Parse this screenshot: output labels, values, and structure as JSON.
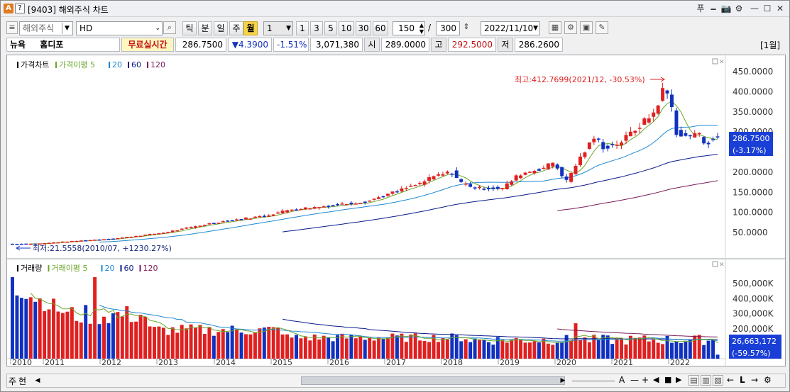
{
  "title": {
    "icon_letter": "A",
    "question": "?",
    "text": "[9403] 해외주식 차트",
    "controls": [
      "푸",
      "🗕",
      "📷",
      "⚙",
      "—",
      "☐",
      "✕"
    ]
  },
  "toolbar": {
    "market_select": "해외주식",
    "symbol": "HD",
    "period_buttons": [
      "틱",
      "분",
      "일",
      "주",
      "월"
    ],
    "active_period": "월",
    "interval_value": "1",
    "interval_buttons": [
      "1",
      "3",
      "5",
      "10",
      "30",
      "60"
    ],
    "count_value": "150",
    "slash": "/",
    "total_value": "300",
    "date_value": "2022/11/10"
  },
  "quote": {
    "exchange": "뉴욕",
    "name": "홈디포",
    "realtime_label": "무료실시간",
    "price": "286.7500",
    "change": "▼4.3900",
    "change_pct": "-1.51%",
    "volume": "3,071,380",
    "open_label": "시",
    "open": "289.0000",
    "high_label": "고",
    "high": "292.5000",
    "low_label": "저",
    "low": "286.2600",
    "period_tag": "[1월]"
  },
  "price_pane": {
    "legend": [
      {
        "label": "가격차트",
        "color": "#000000"
      },
      {
        "label": "가격이평 5",
        "color": "#6aa62a"
      },
      {
        "label": "20",
        "color": "#1e88d2"
      },
      {
        "label": "60",
        "color": "#0a1a8a"
      },
      {
        "label": "120",
        "color": "#7a1a5a"
      }
    ],
    "max_annotation": "최고:412.7699(2021/12, -30.53%)",
    "min_annotation": "최저:21.5558(2010/07, +1230.27%)",
    "axis_labels": [
      "450.0000",
      "400.0000",
      "350.0000",
      "300.0000",
      "250.0000",
      "200.0000",
      "150.0000",
      "100.0000",
      "50.0000"
    ],
    "current_price_tag": "286.7500",
    "current_pct_tag": "(-3.17%)"
  },
  "volume_pane": {
    "legend": [
      {
        "label": "거래량",
        "color": "#000000"
      },
      {
        "label": "거래이평 5",
        "color": "#6aa62a"
      },
      {
        "label": "20",
        "color": "#1e88d2"
      },
      {
        "label": "60",
        "color": "#0a1a8a"
      },
      {
        "label": "120",
        "color": "#7a1a5a"
      }
    ],
    "axis_labels": [
      "500,000K",
      "400,000K",
      "300,000K",
      "200,000K",
      "100,000K"
    ],
    "current_volume_tag": "26,663,172",
    "current_pct_tag": "(-59.57%)"
  },
  "x_axis_years": [
    "2010",
    "2011",
    "2012",
    "2013",
    "2014",
    "2015",
    "2016",
    "2017",
    "2018",
    "2019",
    "2020",
    "2021",
    "2022"
  ],
  "bottom": {
    "left_labels": [
      "주",
      "현"
    ],
    "nav_buttons": [
      "A",
      "—",
      "+",
      "◀",
      "■",
      "▶",
      "←",
      "L",
      "→",
      "⚙"
    ]
  },
  "colors": {
    "up": "#e02020",
    "down": "#1030c0",
    "accent": "#f7d34a",
    "tag_bg": "#1a3fd6"
  },
  "chart_data": {
    "type": "candlestick_with_volume",
    "x_range": [
      "2010-01",
      "2022-11"
    ],
    "price_ylim": [
      0,
      450
    ],
    "price_series_close": [
      [
        "2010",
        25
      ],
      [
        "2011",
        33
      ],
      [
        "2012",
        45
      ],
      [
        "2013",
        70
      ],
      [
        "2014",
        95
      ],
      [
        "2015",
        120
      ],
      [
        "2016",
        130
      ],
      [
        "2017",
        160
      ],
      [
        "2018",
        190
      ],
      [
        "2019",
        215
      ],
      [
        "2020",
        250
      ],
      [
        "2021",
        320
      ],
      [
        "2021-12",
        412.77
      ],
      [
        "2022",
        300
      ],
      [
        "2022-11",
        286.75
      ]
    ],
    "max_point": {
      "date": "2021/12",
      "value": 412.7699
    },
    "min_point": {
      "date": "2010/07",
      "value": 21.5558
    },
    "volume_ylim": [
      0,
      500000000
    ],
    "last_volume": 26663172
  }
}
